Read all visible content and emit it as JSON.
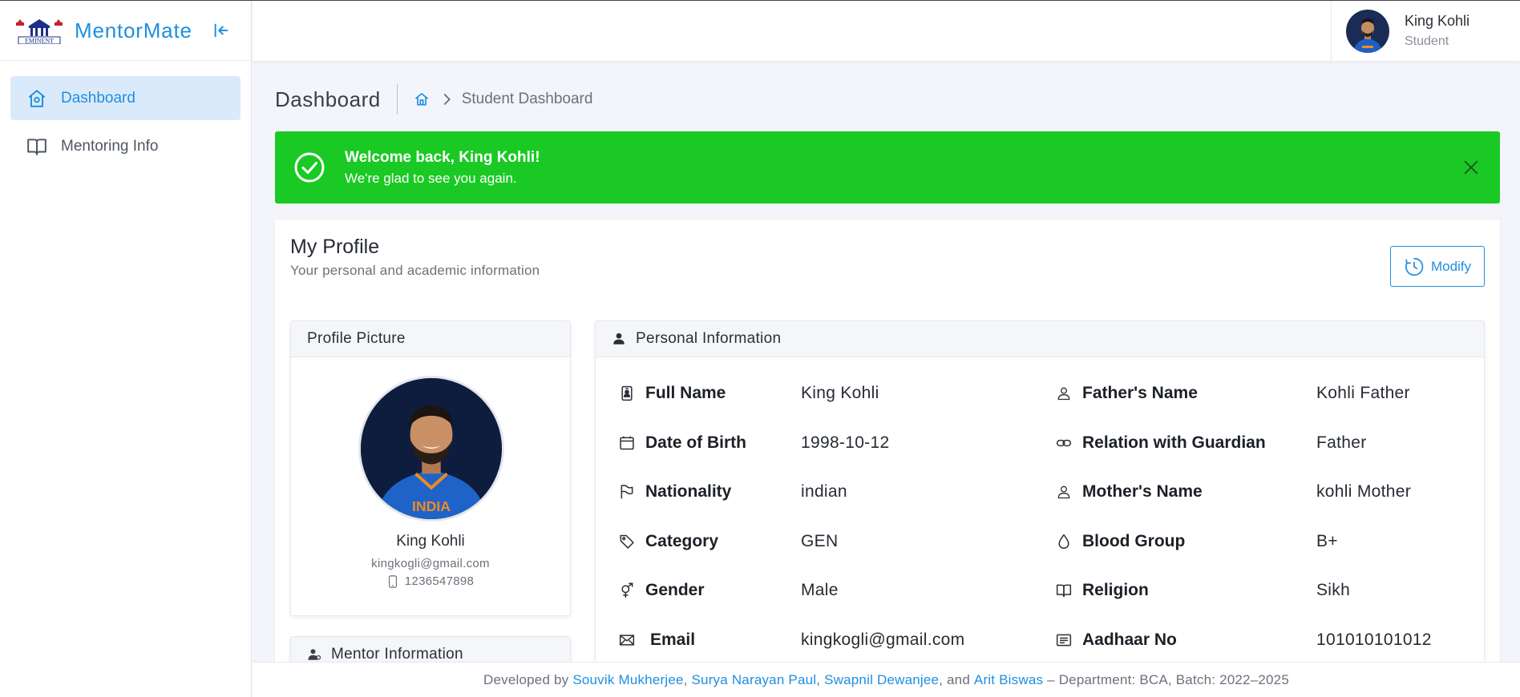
{
  "app": {
    "name": "MentorMate",
    "logo_text": "EMINENT"
  },
  "sidebar": {
    "items": [
      {
        "label": "Dashboard",
        "icon": "home-icon",
        "active": true
      },
      {
        "label": "Mentoring Info",
        "icon": "book-icon",
        "active": false
      }
    ]
  },
  "user": {
    "name": "King Kohli",
    "role": "Student"
  },
  "breadcrumb": {
    "page_title": "Dashboard",
    "current": "Student Dashboard"
  },
  "alert": {
    "title": "Welcome back, King Kohli!",
    "message": "We're glad to see you again.",
    "color": "#1ac924"
  },
  "profile": {
    "title": "My Profile",
    "subtitle": "Your personal and academic information",
    "modify_label": "Modify",
    "picture_header": "Profile Picture",
    "name": "King Kohli",
    "email": "kingkogli@gmail.com",
    "phone": "1236547898",
    "mentor_header": "Mentor Information"
  },
  "personal": {
    "header": "Personal Information",
    "left": [
      {
        "label": "Full Name",
        "value": "King Kohli",
        "icon": "id-badge-icon"
      },
      {
        "label": "Date of Birth",
        "value": "1998-10-12",
        "icon": "calendar-icon"
      },
      {
        "label": "Nationality",
        "value": "indian",
        "icon": "flag-icon"
      },
      {
        "label": "Category",
        "value": "GEN",
        "icon": "tag-icon"
      },
      {
        "label": "Gender",
        "value": "Male",
        "icon": "gender-icon"
      },
      {
        "label": "Email",
        "value": "kingkogli@gmail.com",
        "icon": "envelope-icon"
      }
    ],
    "right": [
      {
        "label": "Father's Name",
        "value": "Kohli Father",
        "icon": "person-icon"
      },
      {
        "label": "Relation with Guardian",
        "value": "Father",
        "icon": "link-icon"
      },
      {
        "label": "Mother's Name",
        "value": "kohli Mother",
        "icon": "person-icon"
      },
      {
        "label": "Blood Group",
        "value": "B+",
        "icon": "droplet-icon"
      },
      {
        "label": "Religion",
        "value": "Sikh",
        "icon": "book-icon"
      },
      {
        "label": "Aadhaar No",
        "value": "101010101012",
        "icon": "card-text-icon"
      }
    ]
  },
  "footer": {
    "prefix": "Developed by",
    "dev1": "Souvik Mukherjee",
    "dev2": "Surya Narayan Paul",
    "dev3": "Swapnil Dewanjee",
    "dev4": "Arit Biswas",
    "suffix": "– Department: BCA, Batch: 2022–2025"
  },
  "colors": {
    "accent": "#1e8fe0",
    "success": "#1ac924",
    "active_bg": "#dbeafb"
  }
}
